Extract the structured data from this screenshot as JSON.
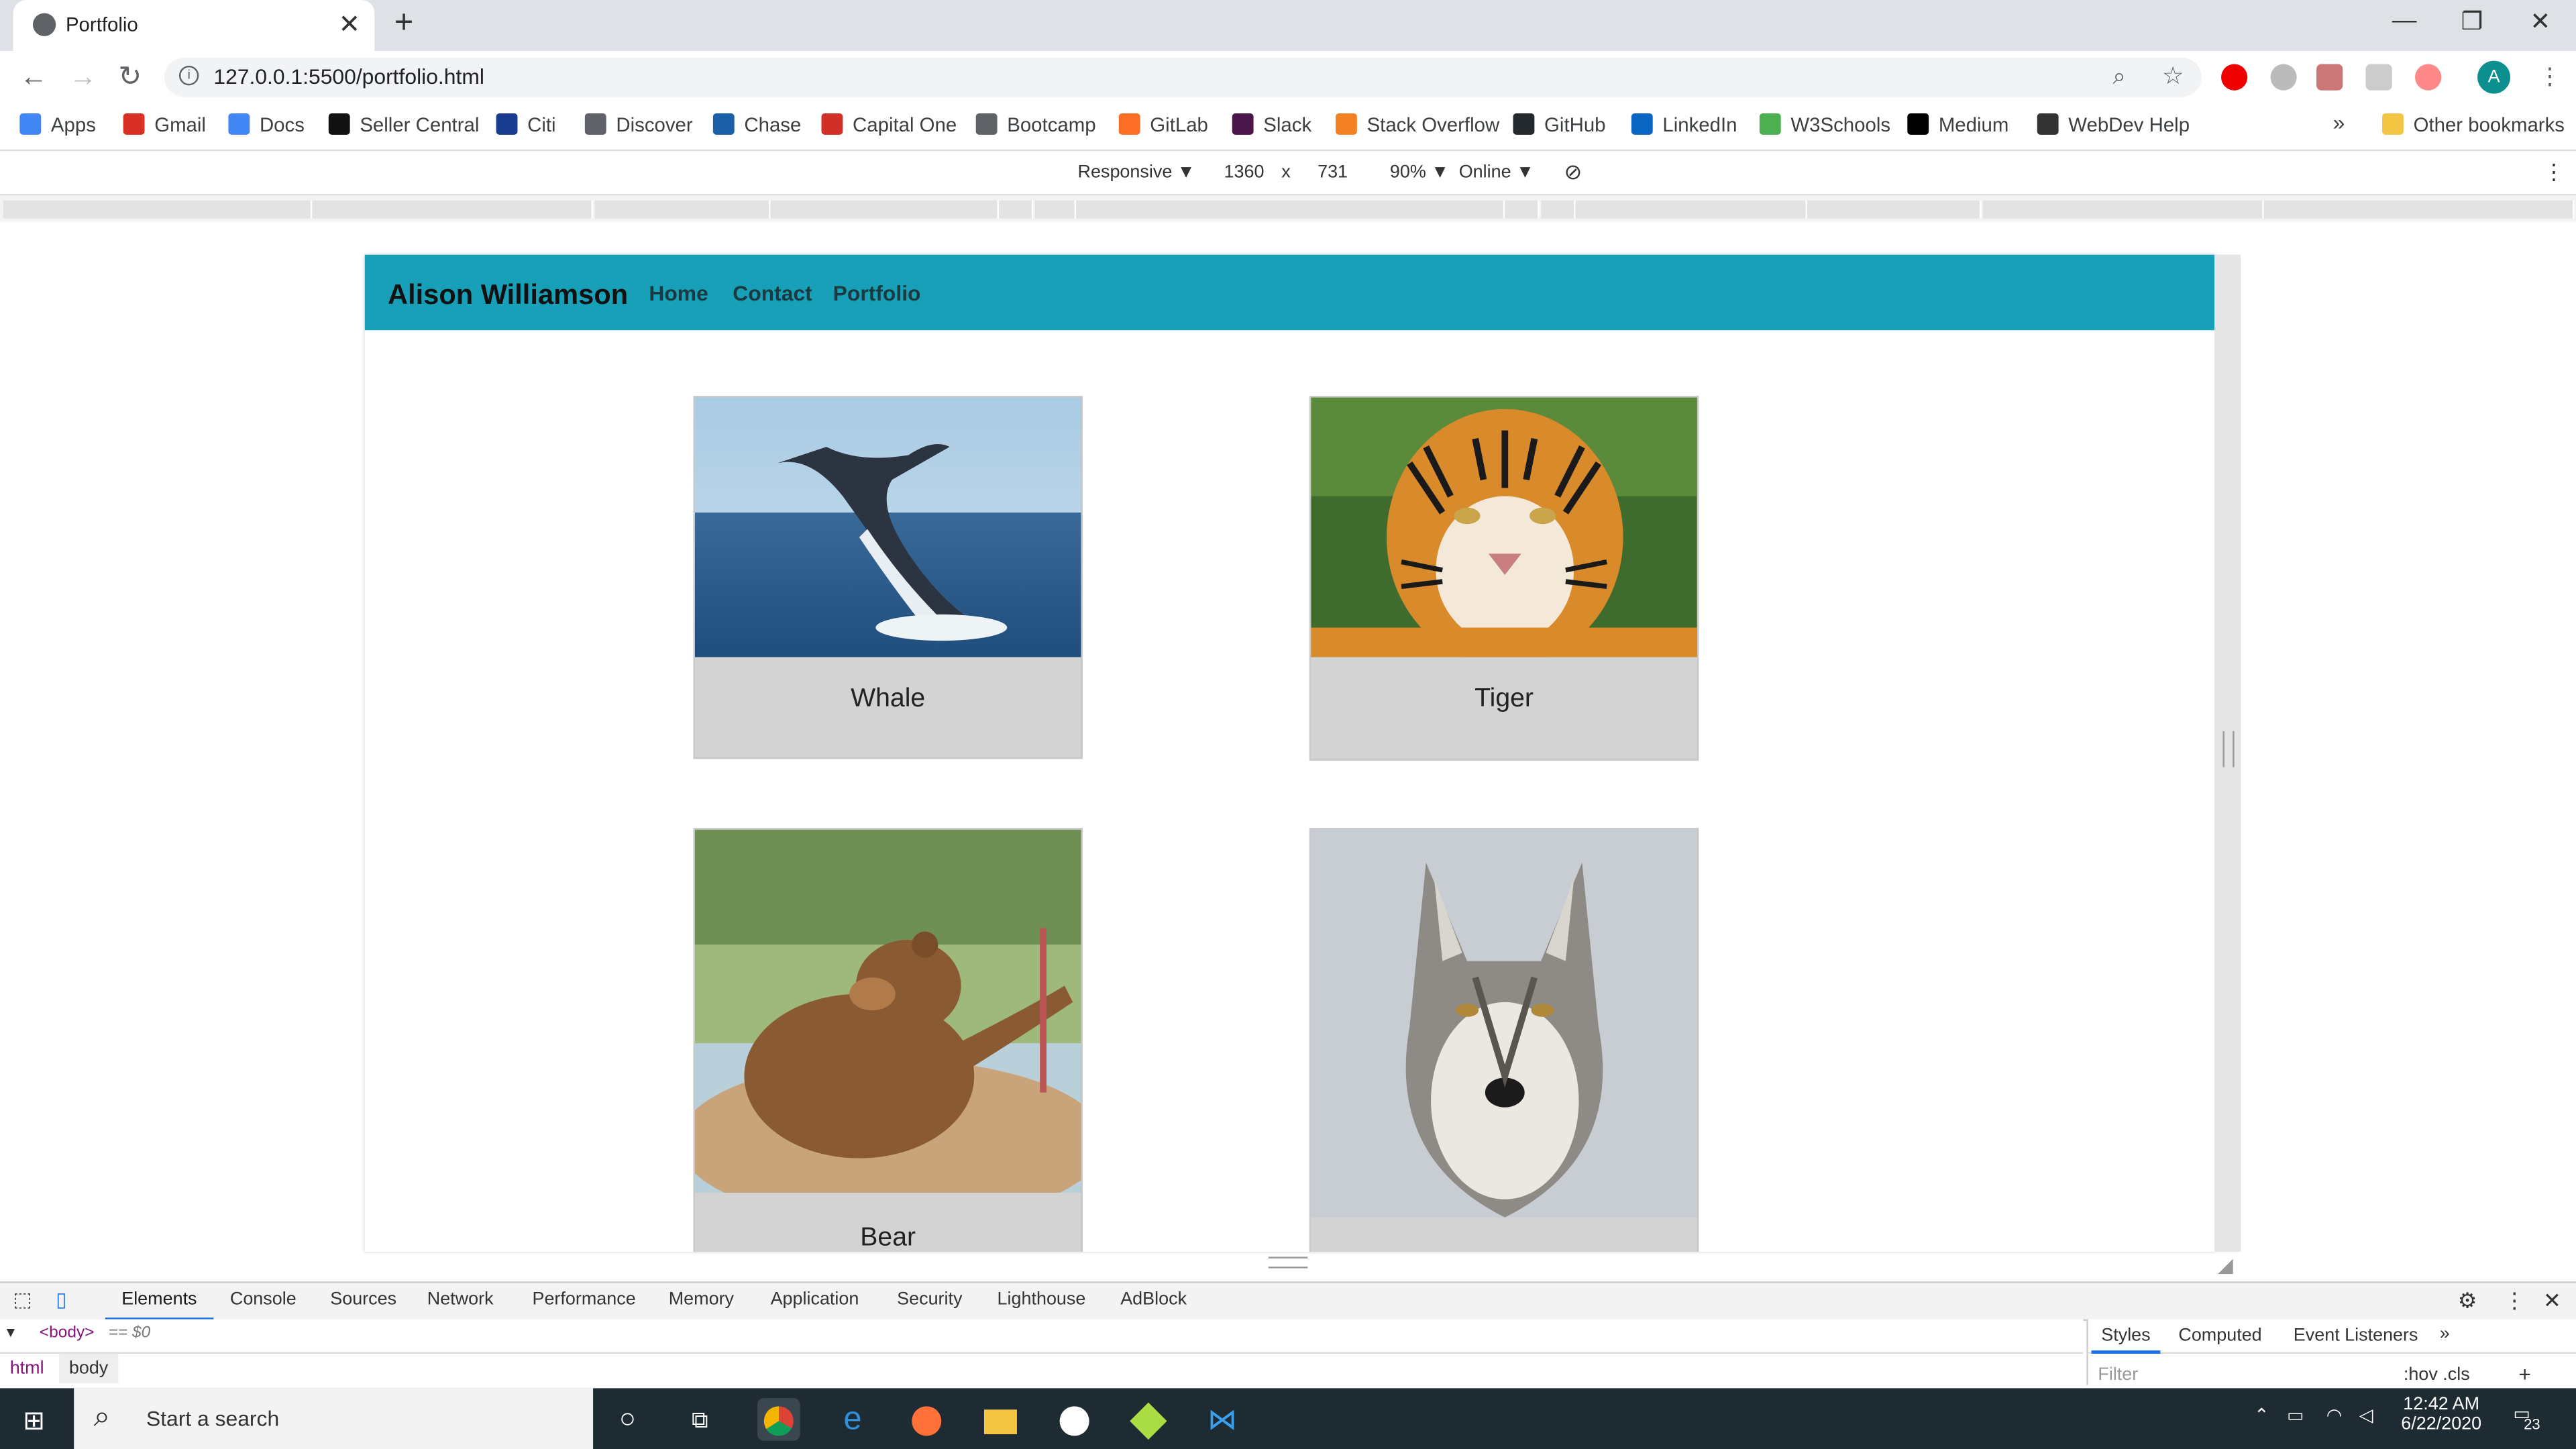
{
  "browser": {
    "tab_title": "Portfolio",
    "url": "127.0.0.1:5500/portfolio.html",
    "profile_initial": "A"
  },
  "bookmarks": [
    {
      "label": "Apps",
      "icon": "apps-grid-icon",
      "color": "#4285f4"
    },
    {
      "label": "Gmail",
      "icon": "gmail-icon",
      "color": "#d93025"
    },
    {
      "label": "Docs",
      "icon": "docs-icon",
      "color": "#4285f4"
    },
    {
      "label": "Seller Central",
      "icon": "amazon-icon",
      "color": "#111111"
    },
    {
      "label": "Citi",
      "icon": "citi-icon",
      "color": "#1a3c8f"
    },
    {
      "label": "Discover",
      "icon": "globe-icon",
      "color": "#5f6368"
    },
    {
      "label": "Chase",
      "icon": "chase-icon",
      "color": "#1a5fa8"
    },
    {
      "label": "Capital One",
      "icon": "capital-one-icon",
      "color": "#d03027"
    },
    {
      "label": "Bootcamp",
      "icon": "globe-icon",
      "color": "#5f6368"
    },
    {
      "label": "GitLab",
      "icon": "gitlab-icon",
      "color": "#fc6d26"
    },
    {
      "label": "Slack",
      "icon": "slack-icon",
      "color": "#4a154b"
    },
    {
      "label": "Stack Overflow",
      "icon": "stackoverflow-icon",
      "color": "#f48024"
    },
    {
      "label": "GitHub",
      "icon": "github-icon",
      "color": "#24292e"
    },
    {
      "label": "LinkedIn",
      "icon": "linkedin-icon",
      "color": "#0a66c2"
    },
    {
      "label": "W3Schools",
      "icon": "w3schools-icon",
      "color": "#4caf50"
    },
    {
      "label": "Medium",
      "icon": "medium-icon",
      "color": "#000000"
    },
    {
      "label": "WebDev Help",
      "icon": "code-icon",
      "color": "#333333"
    }
  ],
  "bookmarks_overflow": "»",
  "other_bookmarks": "Other bookmarks",
  "device_toolbar": {
    "device": "Responsive",
    "width": "1360",
    "times": "x",
    "height": "731",
    "zoom": "90%",
    "throttle": "Online"
  },
  "site": {
    "brand": "Alison Williamson",
    "nav": [
      "Home",
      "Contact",
      "Portfolio"
    ],
    "cards": [
      {
        "caption": "Whale",
        "image": "whale-photo"
      },
      {
        "caption": "Tiger",
        "image": "tiger-photo"
      },
      {
        "caption": "Bear",
        "image": "bear-photo"
      },
      {
        "caption": "",
        "image": "wolf-photo"
      }
    ]
  },
  "devtools": {
    "tabs": [
      "Elements",
      "Console",
      "Sources",
      "Network",
      "Performance",
      "Memory",
      "Application",
      "Security",
      "Lighthouse",
      "AdBlock"
    ],
    "dom_line": "<body>",
    "dom_suffix": "== $0",
    "breadcrumbs": [
      "html",
      "body"
    ],
    "styles_tabs": [
      "Styles",
      "Computed",
      "Event Listeners"
    ],
    "styles_more": "»",
    "filter_placeholder": "Filter",
    "hov_cls": ":hov  .cls",
    "plus": "+"
  },
  "taskbar": {
    "search_text": "Start a search",
    "time": "12:42 AM",
    "date": "6/22/2020",
    "notifications": "23"
  },
  "colors": {
    "navbar": "#17a0b8",
    "card_bg": "#d3d3d3"
  }
}
